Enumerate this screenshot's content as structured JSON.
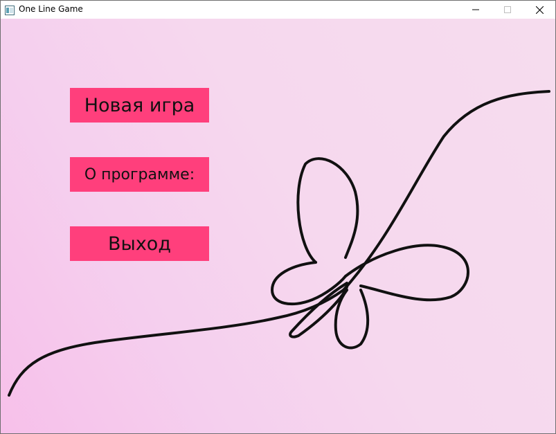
{
  "window": {
    "title": "One Line Game",
    "app_icon": "window-icon",
    "controls": {
      "minimize_icon": "minimize-icon",
      "maximize_icon": "maximize-icon",
      "close_icon": "close-icon"
    }
  },
  "menu": {
    "new_game": "Новая игра",
    "about": "О программе:",
    "exit": "Выход"
  },
  "colors": {
    "button": "#ff3f7c",
    "background": "#f6d8ee",
    "line": "#111111"
  },
  "background_art": "butterfly-line-drawing"
}
